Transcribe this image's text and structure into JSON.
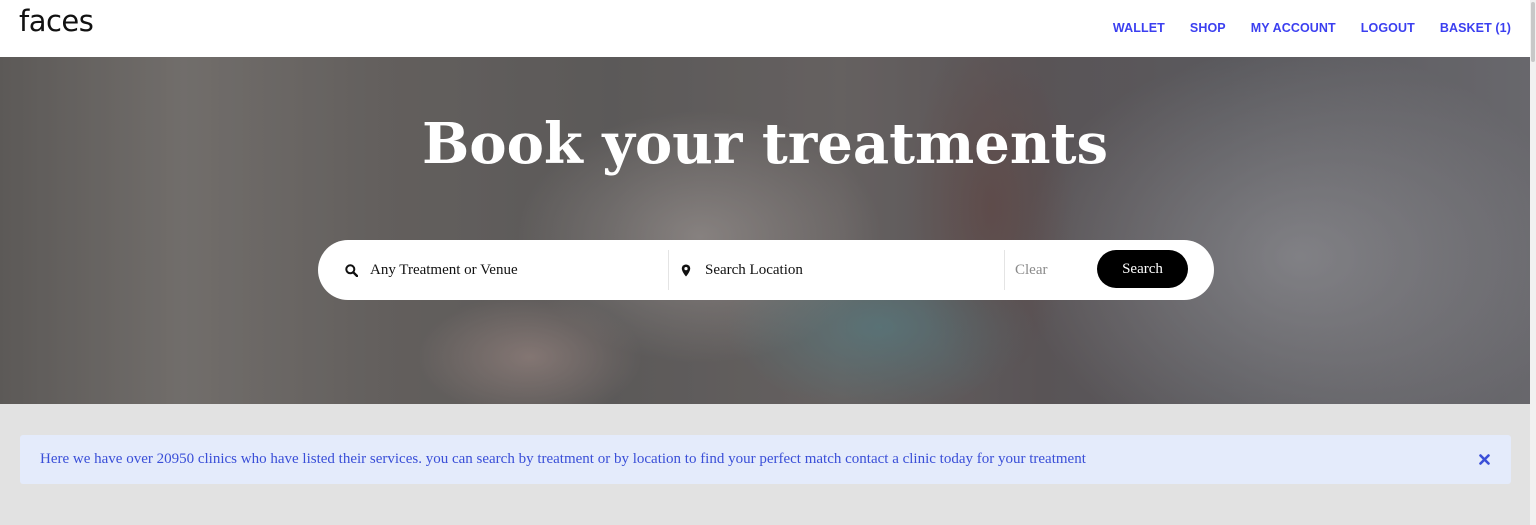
{
  "header": {
    "logo": "faces",
    "nav": [
      {
        "label": "WALLET"
      },
      {
        "label": "SHOP"
      },
      {
        "label": "MY ACCOUNT"
      },
      {
        "label": "LOGOUT"
      },
      {
        "label": "BASKET (1)"
      }
    ]
  },
  "hero": {
    "title": "Book your treatments",
    "search": {
      "treatment_placeholder": "Any Treatment or Venue",
      "treatment_icon": "search-icon",
      "location_placeholder": "Search Location",
      "location_icon": "map-pin-icon",
      "clear_label": "Clear",
      "search_label": "Search"
    }
  },
  "info_banner": {
    "text": "Here we have over 20950 clinics who have listed their services. you can search by treatment or by location to find your perfect match contact a clinic today for your treatment",
    "close_icon": "close-icon"
  },
  "colors": {
    "nav_link": "#3b3ff0",
    "banner_bg": "#e4ebfb",
    "banner_text": "#3a4fd8",
    "page_bg": "#e2e2e2",
    "button_bg": "#000000"
  }
}
